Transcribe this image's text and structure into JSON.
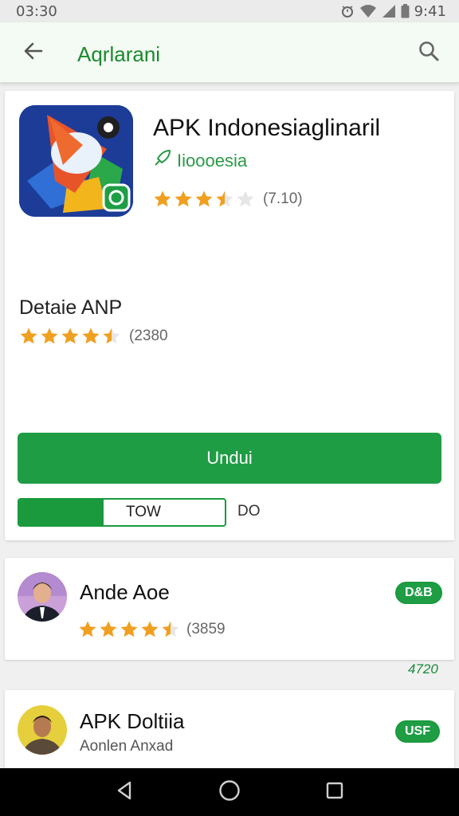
{
  "status_bar": {
    "time_left": "03:30",
    "time_right": "9:41"
  },
  "app_bar": {
    "title": "Aqrlarani",
    "back_icon": "arrow-left-icon",
    "search_icon": "search-icon"
  },
  "app": {
    "name": "APK Indonesiaglinaril",
    "publisher": "Iioooesia",
    "publisher_icon": "rocket-icon",
    "rating_stars": 3.5,
    "rating_count": "(7.10)",
    "details_title": "Detaie ANP",
    "details_rating_stars": 4.5,
    "details_rating_count": "(2380",
    "download_label": "Undui",
    "progress_label": "TOW",
    "progress_fraction": 0.41,
    "progress_side": "DO"
  },
  "list": [
    {
      "title": "Ande Aoe",
      "rating_stars": 4.5,
      "rating_count": "(3859",
      "badge": "D&B"
    },
    {
      "title": "APK Doltiia",
      "subtitle": "Aonlen Anxad",
      "badge": "USF"
    }
  ],
  "floating_number": "4720",
  "colors": {
    "accent": "#1f9d45",
    "star": "#f0a020",
    "app_bar": "#f4faf4"
  },
  "nav": {
    "back_icon": "triangle-back-icon",
    "home_icon": "circle-home-icon",
    "recents_icon": "square-recents-icon"
  }
}
